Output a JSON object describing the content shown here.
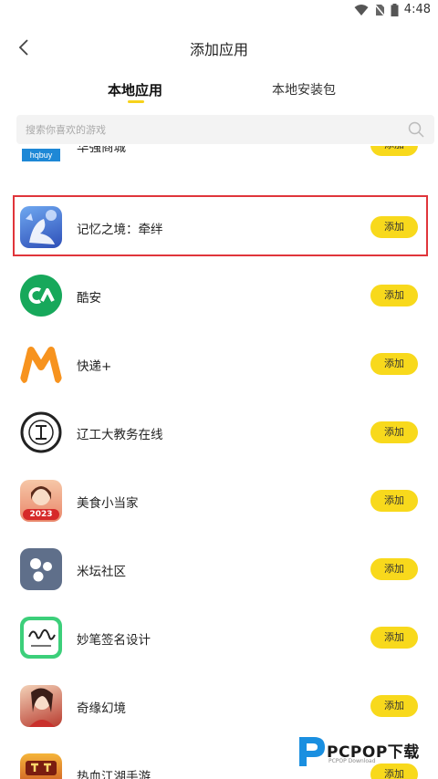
{
  "status_bar": {
    "time": "4:48"
  },
  "header": {
    "title": "添加应用"
  },
  "tabs": [
    {
      "label": "本地应用",
      "active": true
    },
    {
      "label": "本地安装包",
      "active": false
    }
  ],
  "search": {
    "placeholder": "搜索你喜欢的游戏"
  },
  "apps": [
    {
      "name": "华强商城",
      "icon": "hqbuy-logo",
      "icon_text": "hqbuy",
      "button": "添加"
    },
    {
      "name": "记忆之境：牵绊",
      "icon": "memory-realm-icon",
      "button": "添加",
      "highlighted": true
    },
    {
      "name": "酷安",
      "icon": "coolapk-icon",
      "button": "添加"
    },
    {
      "name": "快递+",
      "icon": "kuaidi-m-icon",
      "button": "添加"
    },
    {
      "name": "辽工大教务在线",
      "icon": "lntu-seal-icon",
      "button": "添加"
    },
    {
      "name": "美食小当家",
      "icon": "food-game-icon",
      "icon_text": "2023",
      "button": "添加"
    },
    {
      "name": "米坛社区",
      "icon": "mitan-dots-icon",
      "button": "添加"
    },
    {
      "name": "妙笔签名设计",
      "icon": "signature-icon",
      "button": "添加"
    },
    {
      "name": "奇缘幻境",
      "icon": "fantasy-game-icon",
      "button": "添加"
    },
    {
      "name": "热血江湖手游",
      "icon": "rexue-game-icon",
      "button": "添加"
    }
  ],
  "watermark": {
    "brand": "PCPOP下载",
    "sub": "PCPOP Download"
  },
  "colors": {
    "accent": "#f8d91c",
    "highlight_border": "#e0353b",
    "coolapk_green": "#17a85b"
  }
}
